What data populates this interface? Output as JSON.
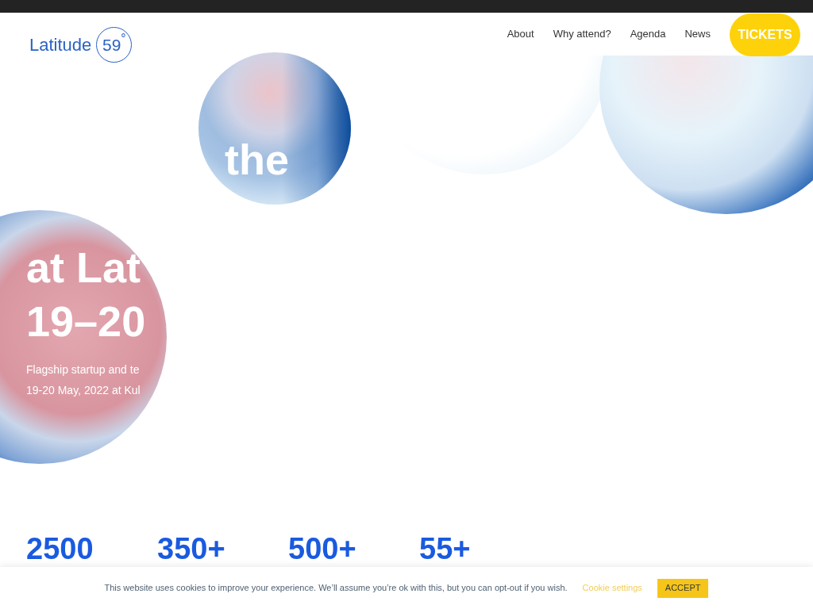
{
  "header": {
    "logo": {
      "wordmark": "Latitude",
      "badge": "59$^{°}$"
    },
    "nav": [
      {
        "label": "About"
      },
      {
        "label": "Why attend?"
      },
      {
        "label": "Agenda"
      },
      {
        "label": "News"
      }
    ],
    "cta": "TICKETS"
  },
  "hero": {
    "heading_lines": [
      "the",
      "at Lat",
      "19–20"
    ],
    "subtitle_lines": [
      "Flagship startup and te",
      "19-20 May, 2022 at Kul"
    ]
  },
  "stats": [
    {
      "value": "2500"
    },
    {
      "value": "350+"
    },
    {
      "value": "500+"
    },
    {
      "value": "55+"
    }
  ],
  "cookie_bar": {
    "message": "This website uses cookies to improve your experience. We’ll assume you’re ok with this, but you can opt-out if you wish.",
    "settings_link": "Cookie settings",
    "accept_button": "ACCEPT"
  }
}
